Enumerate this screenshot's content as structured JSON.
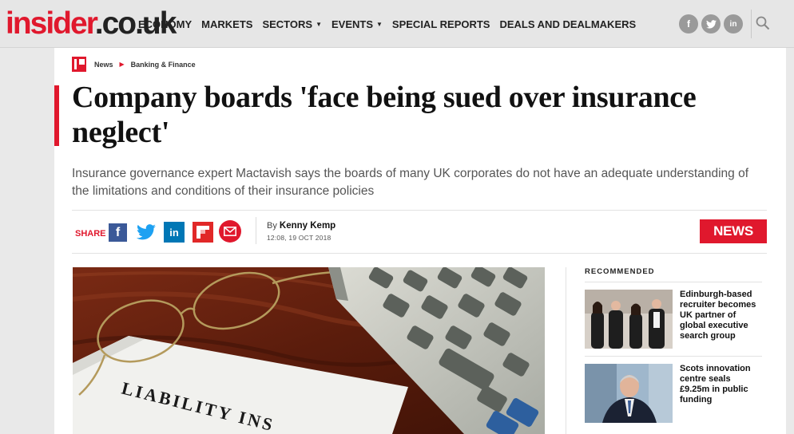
{
  "site": {
    "logo_part1": "insider",
    "logo_part2": ".co.uk"
  },
  "nav": [
    {
      "label": "ECONOMY",
      "dropdown": false
    },
    {
      "label": "MARKETS",
      "dropdown": false
    },
    {
      "label": "SECTORS",
      "dropdown": true
    },
    {
      "label": "EVENTS",
      "dropdown": true
    },
    {
      "label": "SPECIAL REPORTS",
      "dropdown": false
    },
    {
      "label": "DEALS AND DEALMAKERS",
      "dropdown": false
    }
  ],
  "social_top": [
    {
      "icon": "facebook-icon",
      "glyph": "f"
    },
    {
      "icon": "twitter-icon",
      "glyph": "t"
    },
    {
      "icon": "linkedin-icon",
      "glyph": "in"
    }
  ],
  "breadcrumb": {
    "first": "News",
    "second": "Banking & Finance"
  },
  "article": {
    "headline": "Company boards 'face being sued over insurance neglect'",
    "standfirst": "Insurance governance expert Mactavish says the boards of many UK corporates do not have an adequate understanding of the limitations and conditions of their insurance policies",
    "share_label": "SHARE",
    "byline_prefix": "By",
    "author": "Kenny Kemp",
    "date": "12:08, 19 OCT 2018",
    "badge": "NEWS",
    "hero_text": "LIABILITY INS"
  },
  "share_buttons": [
    {
      "icon": "facebook-icon",
      "color": "#3b5998"
    },
    {
      "icon": "twitter-icon",
      "color": "#1da1f2"
    },
    {
      "icon": "linkedin-icon",
      "color": "#0077b5"
    },
    {
      "icon": "flipboard-icon",
      "color": "#e12828"
    },
    {
      "icon": "email-icon",
      "color": "#e0182d"
    }
  ],
  "recommended": {
    "title": "RECOMMENDED",
    "items": [
      {
        "title": "Edinburgh-based recruiter becomes UK partner of global executive search group"
      },
      {
        "title": "Scots innovation centre seals £9.25m in public funding"
      }
    ]
  },
  "colors": {
    "brand_red": "#e0182d",
    "header_bg": "#e6e6e6"
  }
}
